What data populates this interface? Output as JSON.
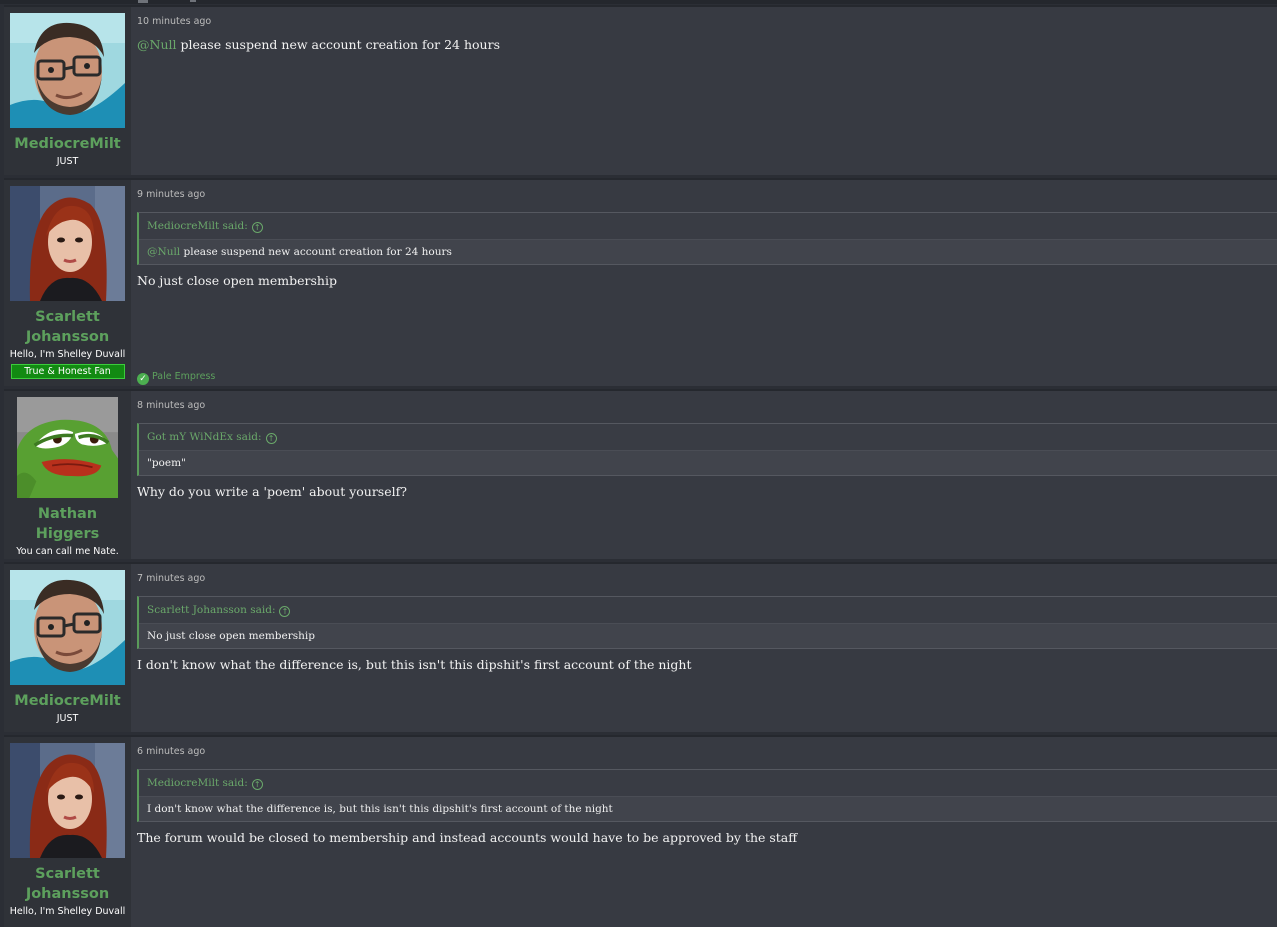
{
  "posts": [
    {
      "author": "MediocreMilt",
      "title": "JUST",
      "time": "10 minutes ago",
      "mention": "@Null",
      "text": " please suspend new account creation for 24 hours"
    },
    {
      "author": "Scarlett Johansson",
      "title": "Hello, I'm Shelley Duvall",
      "banner": "True & Honest Fan",
      "time": "9 minutes ago",
      "quote_author": "MediocreMilt said:",
      "quote_mention": "@Null",
      "quote_text": " please suspend new account creation for 24 hours",
      "text": "No just close open membership",
      "reaction": "Pale Empress"
    },
    {
      "author": "Nathan Higgers",
      "title": "You can call me Nate.",
      "time": "8 minutes ago",
      "quote_author": "Got mY WiNdEx said:",
      "quote_text": "\"poem\"",
      "text": "Why do you write a 'poem' about yourself?"
    },
    {
      "author": "MediocreMilt",
      "title": "JUST",
      "time": "7 minutes ago",
      "quote_author": "Scarlett Johansson said:",
      "quote_text": "No just close open membership",
      "text": "I don't know what the difference is, but this isn't this dipshit's first account of the night"
    },
    {
      "author": "Scarlett Johansson",
      "title": "Hello, I'm Shelley Duvall",
      "time": "6 minutes ago",
      "quote_author": "MediocreMilt said:",
      "quote_text": "I don't know what the difference is, but this isn't this dipshit's first account of the night",
      "text": "The forum would be closed to membership and instead accounts would have to be approved by the staff"
    }
  ],
  "icons": {
    "quote_jump": "arrow-up-circle-icon",
    "reaction": "check-circle-icon"
  },
  "colors": {
    "username": "#5da05d",
    "mention": "#6aa86a",
    "banner": "#128a12",
    "background": "#373a42"
  }
}
